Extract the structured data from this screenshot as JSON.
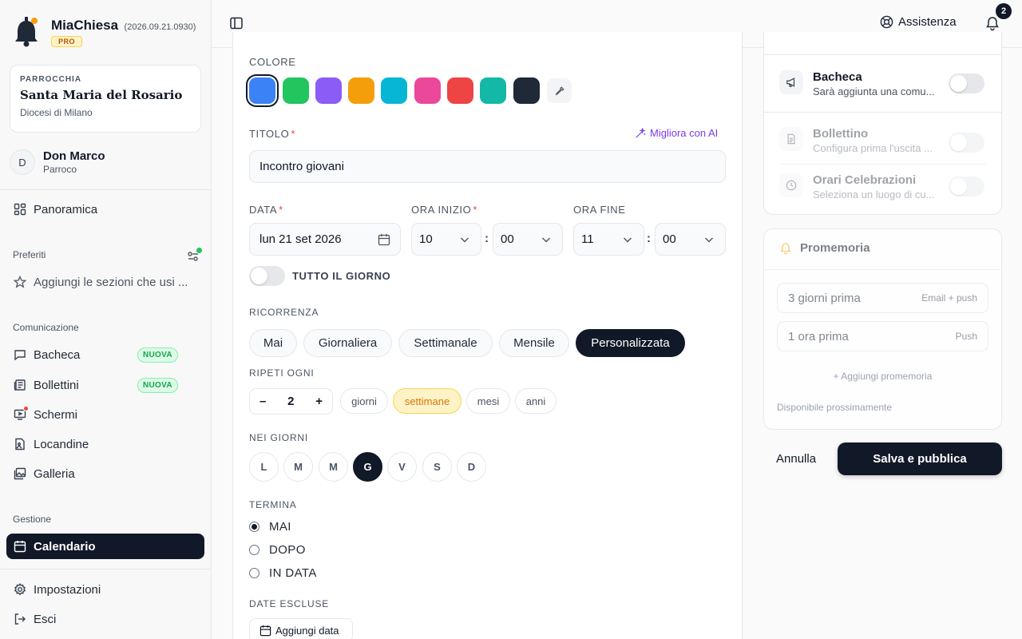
{
  "app": {
    "name": "MiaChiesa",
    "version": "(2026.09.21.0930)",
    "plan": "PRO"
  },
  "parish": {
    "label": "PARROCCHIA",
    "name": "Santa Maria del Rosario",
    "diocese": "Diocesi di Milano"
  },
  "user": {
    "initial": "D",
    "name": "Don Marco",
    "role": "Parroco"
  },
  "sidebar": {
    "overview": "Panoramica",
    "favorites_title": "Preferiti",
    "favorites_hint": "Aggiungi le sezioni che usi ...",
    "comm_title": "Comunicazione",
    "comm_items": [
      {
        "label": "Bacheca",
        "badge": "NUOVA"
      },
      {
        "label": "Bollettini",
        "badge": "NUOVA"
      },
      {
        "label": "Schermi"
      },
      {
        "label": "Locandine"
      },
      {
        "label": "Galleria"
      }
    ],
    "mgmt_title": "Gestione",
    "calendar": "Calendario",
    "settings": "Impostazioni",
    "logout": "Esci"
  },
  "topbar": {
    "help": "Assistenza",
    "notifications": "2"
  },
  "form": {
    "color_label": "COLORE",
    "colors": [
      "#3b82f6",
      "#22c55e",
      "#8b5cf6",
      "#f59e0b",
      "#06b6d4",
      "#ec4899",
      "#ef4444",
      "#14b8a6",
      "#1f2937"
    ],
    "title_label": "TITOLO",
    "ai_label": "Migliora con AI",
    "title_value": "Incontro giovani",
    "date_label": "DATA",
    "date_value": "lun 21 set 2026",
    "start_label": "ORA INIZIO",
    "start_hour": "10",
    "start_min": "00",
    "end_label": "ORA FINE",
    "end_hour": "11",
    "end_min": "00",
    "allday_label": "TUTTO IL GIORNO",
    "recurrence_label": "RICORRENZA",
    "recurrence_options": [
      "Mai",
      "Giornaliera",
      "Settimanale",
      "Mensile",
      "Personalizzata"
    ],
    "recurrence_selected": "Personalizzata",
    "repeat_label": "RIPETI OGNI",
    "repeat_minus": "–",
    "repeat_value": "2",
    "repeat_plus": "+",
    "units": [
      "giorni",
      "settimane",
      "mesi",
      "anni"
    ],
    "unit_selected": "settimane",
    "days_label": "NEI GIORNI",
    "days": [
      "L",
      "M",
      "M",
      "G",
      "V",
      "S",
      "D"
    ],
    "day_selected_index": 3,
    "ends_label": "TERMINA",
    "ends_options": [
      "MAI",
      "DOPO",
      "IN DATA"
    ],
    "ends_selected": "MAI",
    "excluded_label": "DATE ESCLUSE",
    "add_date": "Aggiungi data"
  },
  "publish": {
    "items": [
      {
        "title": "Bacheca",
        "sub": "Sarà aggiunta una comu...",
        "enabled": true
      },
      {
        "title": "Bollettino",
        "sub": "Configura prima l'uscita ...",
        "enabled": false
      },
      {
        "title": "Orari Celebrazioni",
        "sub": "Seleziona un luogo di cu...",
        "enabled": false
      }
    ]
  },
  "reminders": {
    "title": "Promemoria",
    "items": [
      {
        "label": "3 giorni prima",
        "channel": "Email + push"
      },
      {
        "label": "1 ora prima",
        "channel": "Push"
      }
    ],
    "add": "+ Aggiungi promemoria",
    "note": "Disponibile prossimamente"
  },
  "actions": {
    "cancel": "Annulla",
    "save": "Salva e pubblica"
  }
}
